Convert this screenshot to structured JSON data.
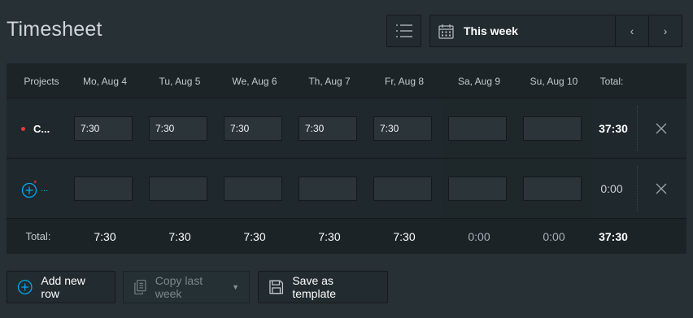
{
  "page": {
    "title": "Timesheet"
  },
  "toolbar": {
    "week_label": "This week",
    "prev_icon": "‹",
    "next_icon": "›"
  },
  "table": {
    "headers": {
      "project": "Projects",
      "days": [
        "Mo, Aug 4",
        "Tu, Aug 5",
        "We, Aug 6",
        "Th, Aug 7",
        "Fr, Aug 8",
        "Sa, Aug 9",
        "Su, Aug 10"
      ],
      "total": "Total:"
    },
    "rows": [
      {
        "project": "C...",
        "project_color": "#e53935",
        "hours": [
          "7:30",
          "7:30",
          "7:30",
          "7:30",
          "7:30",
          "",
          ""
        ],
        "total": "37:30"
      },
      {
        "project": "...",
        "hours": [
          "",
          "",
          "",
          "",
          "",
          "",
          ""
        ],
        "total": "0:00"
      }
    ],
    "totals": {
      "label": "Total:",
      "days": [
        "7:30",
        "7:30",
        "7:30",
        "7:30",
        "7:30",
        "0:00",
        "0:00"
      ],
      "grand": "37:30"
    }
  },
  "actions": {
    "add_row": "Add new row",
    "copy_last_week": "Copy last week",
    "save_template": "Save as template"
  },
  "colors": {
    "accent": "#03a9f4",
    "required": "#e53935"
  }
}
